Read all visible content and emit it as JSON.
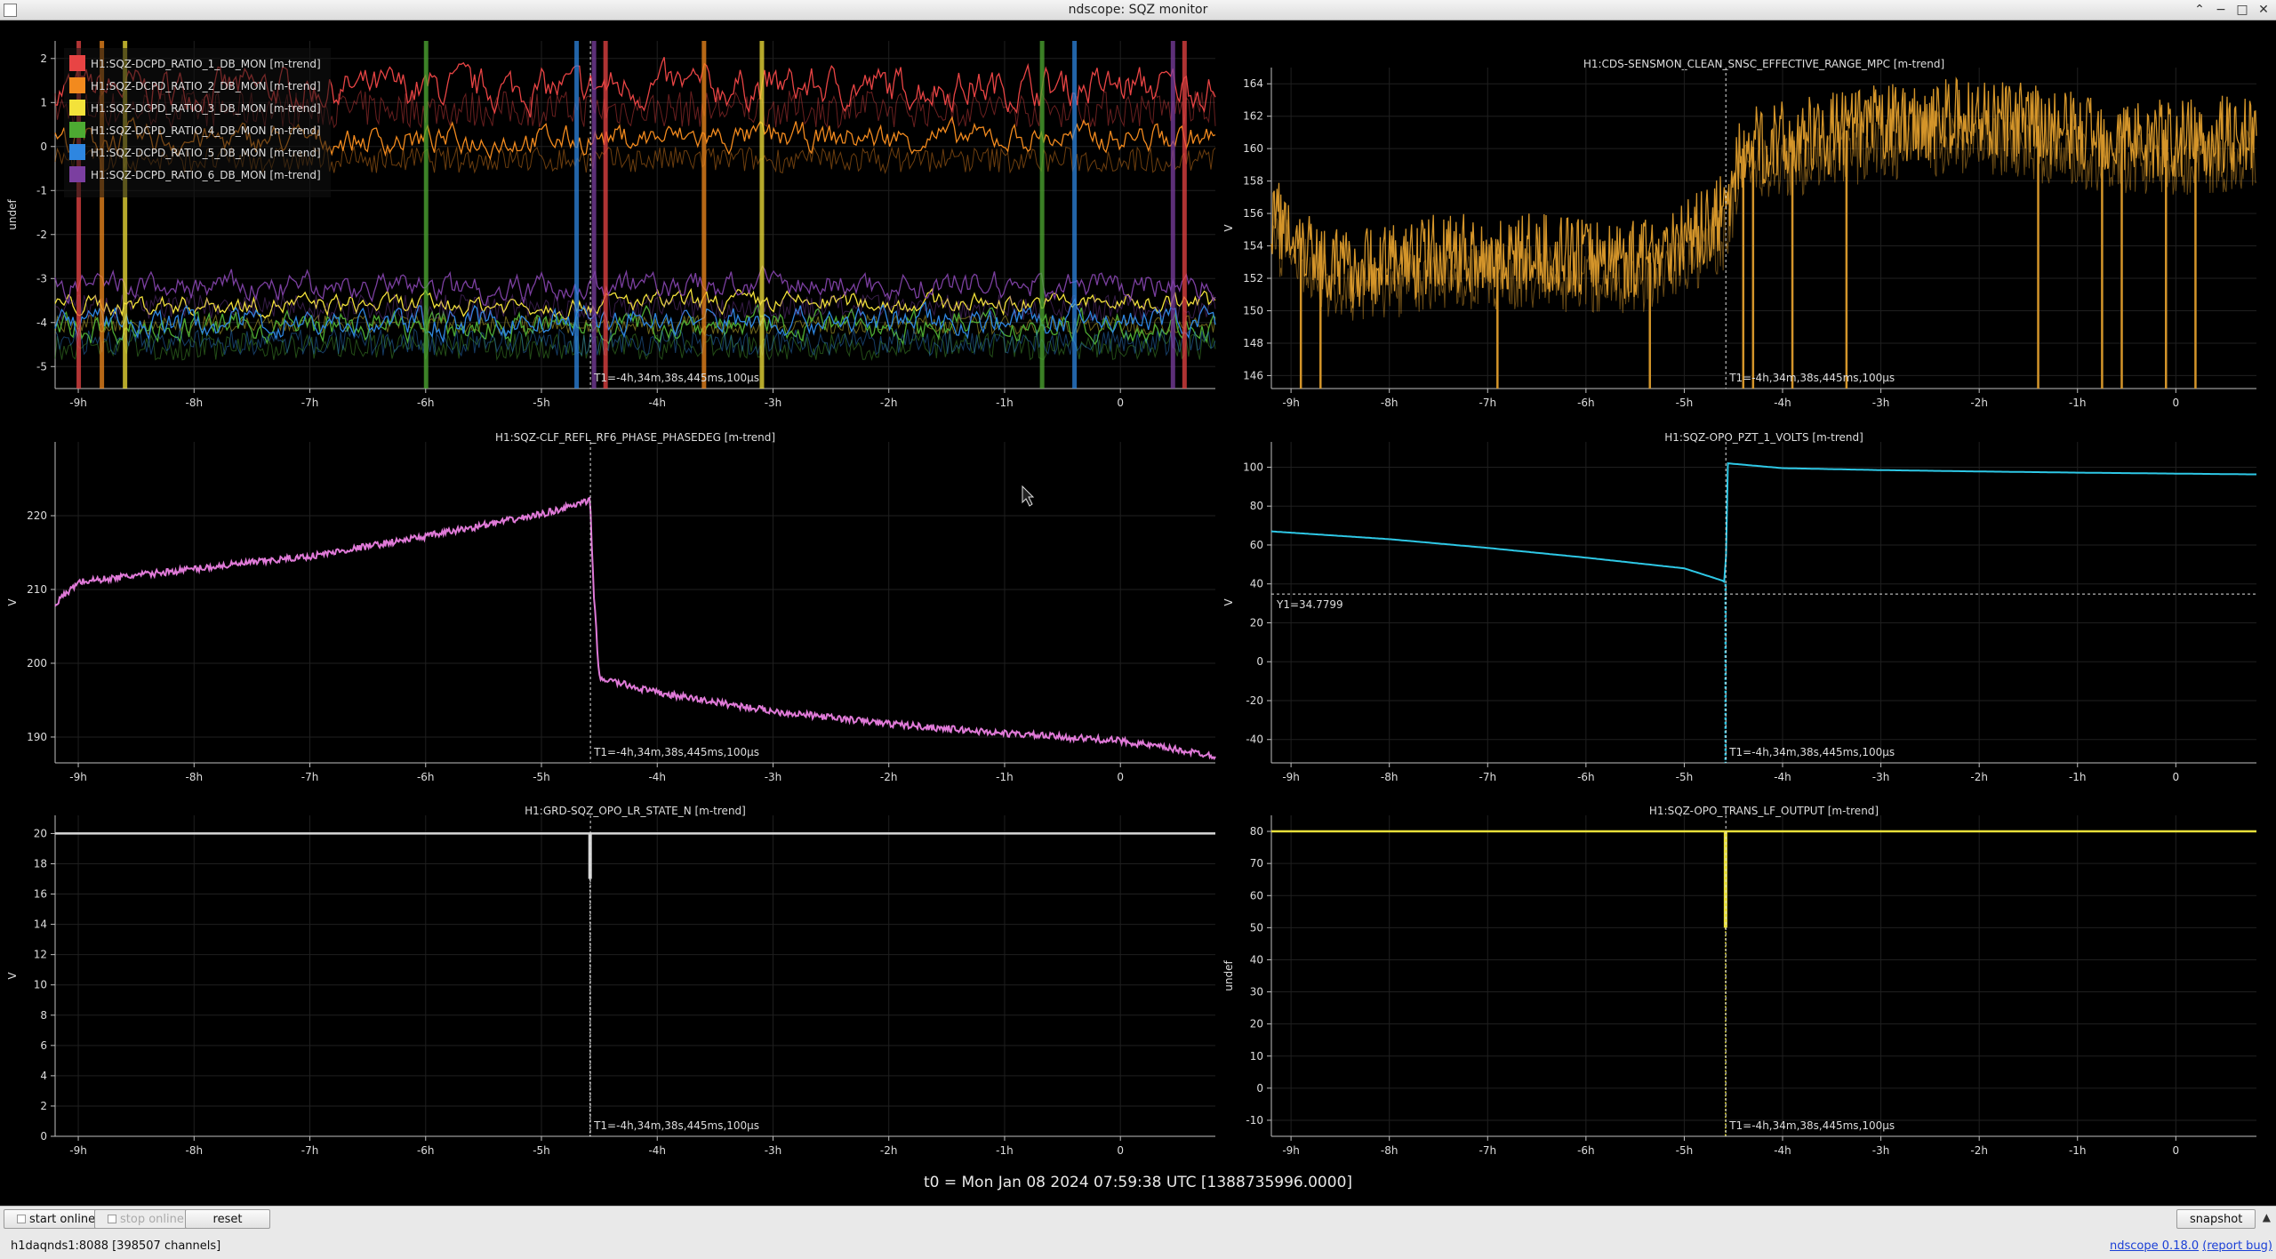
{
  "window": {
    "title": "ndscope: SQZ monitor"
  },
  "colors": {
    "bg": "#000000",
    "grid": "#1f1f1f",
    "axis": "#bfbfbf",
    "text": "#dddddd",
    "cursor": "#e0e0e0",
    "ratio1": "#e84444",
    "ratio2": "#f28a1e",
    "ratio3": "#f3e23a",
    "ratio4": "#4daa32",
    "ratio5": "#2e86e0",
    "ratio6": "#7b3fa0",
    "range": "#d4952a",
    "clf": "#e07ad8",
    "pzt": "#2ec8e6",
    "guard": "#d8d8d8",
    "trans": "#e8e03a"
  },
  "cursor": {
    "t1_label": "T1=-4h,34m,38s,445ms,100µs",
    "t1_value": -4.577,
    "y1_label": "Y1=34.7799",
    "y1_value": 34.78
  },
  "t0_text": "t0 = Mon Jan 08 2024 07:59:38 UTC [1388735996.0000]",
  "x_axis": {
    "min": -9.2,
    "max": 0.82,
    "ticks": [
      -9,
      -8,
      -7,
      -6,
      -5,
      -4,
      -3,
      -2,
      -1,
      0
    ],
    "tick_labels": [
      "-9h",
      "-8h",
      "-7h",
      "-6h",
      "-5h",
      "-4h",
      "-3h",
      "-2h",
      "-1h",
      "0"
    ]
  },
  "plots": [
    {
      "id": "ratios",
      "title": "",
      "ylabel": "undef",
      "ylim": [
        -5.5,
        2.4
      ],
      "yticks": [
        2,
        1,
        0,
        -1,
        -2,
        -3,
        -4,
        -5
      ],
      "legend": [
        {
          "name": "H1:SQZ-DCPD_RATIO_1_DB_MON [m-trend]",
          "color": "#e84444"
        },
        {
          "name": "H1:SQZ-DCPD_RATIO_2_DB_MON [m-trend]",
          "color": "#f28a1e"
        },
        {
          "name": "H1:SQZ-DCPD_RATIO_3_DB_MON [m-trend]",
          "color": "#f3e23a"
        },
        {
          "name": "H1:SQZ-DCPD_RATIO_4_DB_MON [m-trend]",
          "color": "#4daa32"
        },
        {
          "name": "H1:SQZ-DCPD_RATIO_5_DB_MON [m-trend]",
          "color": "#2e86e0"
        },
        {
          "name": "H1:SQZ-DCPD_RATIO_6_DB_MON [m-trend]",
          "color": "#7b3fa0"
        }
      ],
      "chart_data": {
        "type": "line",
        "x_unit": "h",
        "series": [
          {
            "name": "H1:SQZ-DCPD_RATIO_1_DB_MON [m-trend]",
            "color": "#e84444",
            "baseline": 1.3,
            "noise": 0.35
          },
          {
            "name": "H1:SQZ-DCPD_RATIO_2_DB_MON [m-trend]",
            "color": "#f28a1e",
            "baseline": 0.15,
            "noise": 0.25
          },
          {
            "name": "H1:SQZ-DCPD_RATIO_3_DB_MON [m-trend]",
            "color": "#f3e23a",
            "baseline": -3.6,
            "noise": 0.18
          },
          {
            "name": "H1:SQZ-DCPD_RATIO_4_DB_MON [m-trend]",
            "color": "#4daa32",
            "baseline": -4.1,
            "noise": 0.25
          },
          {
            "name": "H1:SQZ-DCPD_RATIO_5_DB_MON [m-trend]",
            "color": "#2e86e0",
            "baseline": -4.0,
            "noise": 0.25
          },
          {
            "name": "H1:SQZ-DCPD_RATIO_6_DB_MON [m-trend]",
            "color": "#7b3fa0",
            "baseline": -3.2,
            "noise": 0.25
          }
        ],
        "glitches_h": [
          -9.0,
          -8.8,
          -8.6,
          -6.0,
          -4.7,
          -4.55,
          -4.45,
          -3.6,
          -3.1,
          -0.68,
          -0.4,
          0.45,
          0.55
        ]
      }
    },
    {
      "id": "range",
      "title": "H1:CDS-SENSMON_CLEAN_SNSC_EFFECTIVE_RANGE_MPC [m-trend]",
      "ylabel": "V",
      "ylim": [
        145.2,
        165
      ],
      "yticks": [
        164,
        162,
        160,
        158,
        156,
        154,
        152,
        150,
        148,
        146
      ],
      "chart_data": {
        "type": "line",
        "x_unit": "h",
        "series": [
          {
            "name": "",
            "color": "#d4952a",
            "x": [
              -9.2,
              -8.5,
              -7.5,
              -6.5,
              -5.5,
              -4.8,
              -4.6,
              -4.4,
              -3.0,
              -2.0,
              -1.0,
              0.0,
              0.8
            ],
            "y": [
              156,
              152.5,
              153.5,
              153.5,
              153.2,
              155,
              156,
              160,
              161.5,
              162,
              161,
              160.5,
              161
            ]
          }
        ],
        "drops_h": [
          -8.9,
          -8.7,
          -6.9,
          -5.35,
          -4.4,
          -4.3,
          -3.9,
          -3.35,
          -1.4,
          -0.75,
          -0.55,
          -0.1,
          0.2
        ]
      }
    },
    {
      "id": "clf",
      "title": "H1:SQZ-CLF_REFL_RF6_PHASE_PHASEDEG [m-trend]",
      "ylabel": "V",
      "ylim": [
        186.5,
        230
      ],
      "yticks": [
        220,
        210,
        200,
        190
      ],
      "chart_data": {
        "type": "line",
        "x_unit": "h",
        "series": [
          {
            "name": "",
            "color": "#e07ad8",
            "x": [
              -9.2,
              -9.0,
              -8.0,
              -7.0,
              -6.0,
              -5.0,
              -4.58,
              -4.55,
              -4.5,
              -4.0,
              -3.0,
              -2.0,
              -1.0,
              0.0,
              0.8
            ],
            "y": [
              208,
              211,
              212.8,
              214.5,
              217.2,
              220.2,
              222,
              210,
              198,
              196,
              193.5,
              191.8,
              190.5,
              189.5,
              187.5
            ]
          }
        ]
      }
    },
    {
      "id": "pzt",
      "title": "H1:SQZ-OPO_PZT_1_VOLTS [m-trend]",
      "ylabel": "V",
      "ylim": [
        -52,
        113
      ],
      "yticks": [
        100,
        80,
        60,
        40,
        20,
        0,
        -20,
        -40
      ],
      "chart_data": {
        "type": "line",
        "x_unit": "h",
        "series": [
          {
            "name": "",
            "color": "#2ec8e6",
            "x": [
              -9.2,
              -8.0,
              -7.0,
              -6.0,
              -5.0,
              -4.6,
              -4.58,
              -4.56,
              -4.0,
              -3.0,
              -2.0,
              -1.0,
              0.0,
              0.8
            ],
            "y": [
              67,
              63,
              58.5,
              53.5,
              48,
              41.5,
              40,
              102,
              99.5,
              98.5,
              97.8,
              97.2,
              96.7,
              96.3
            ]
          }
        ],
        "spike_h": -4.58,
        "spike_min": -52
      }
    },
    {
      "id": "guard",
      "title": "H1:GRD-SQZ_OPO_LR_STATE_N [m-trend]",
      "ylabel": "V",
      "ylim": [
        0,
        21.2
      ],
      "yticks": [
        20,
        18,
        16,
        14,
        12,
        10,
        8,
        6,
        4,
        2,
        0
      ],
      "chart_data": {
        "type": "line",
        "x_unit": "h",
        "series": [
          {
            "name": "",
            "color": "#d8d8d8",
            "x": [
              -9.2,
              0.82
            ],
            "y": [
              20,
              20
            ]
          }
        ],
        "dip_h": -4.58,
        "dip_main": 17,
        "dip_min": 0
      }
    },
    {
      "id": "trans",
      "title": "H1:SQZ-OPO_TRANS_LF_OUTPUT [m-trend]",
      "ylabel": "undef",
      "ylim": [
        -15,
        85
      ],
      "yticks": [
        80,
        70,
        60,
        50,
        40,
        30,
        20,
        10,
        0,
        -10
      ],
      "chart_data": {
        "type": "line",
        "x_unit": "h",
        "series": [
          {
            "name": "",
            "color": "#e8e03a",
            "x": [
              -9.2,
              0.82
            ],
            "y": [
              80,
              80
            ]
          }
        ],
        "dip_h": -4.58,
        "dip_main": 50,
        "dip_min": -15
      }
    }
  ],
  "buttons": {
    "start_online": "start online",
    "stop_online": "stop online",
    "reset": "reset",
    "snapshot": "snapshot"
  },
  "status": {
    "server": "h1daqnds1:8088  [398507 channels]",
    "version_link": "ndscope 0.18.0",
    "report_link": "(report bug)"
  }
}
